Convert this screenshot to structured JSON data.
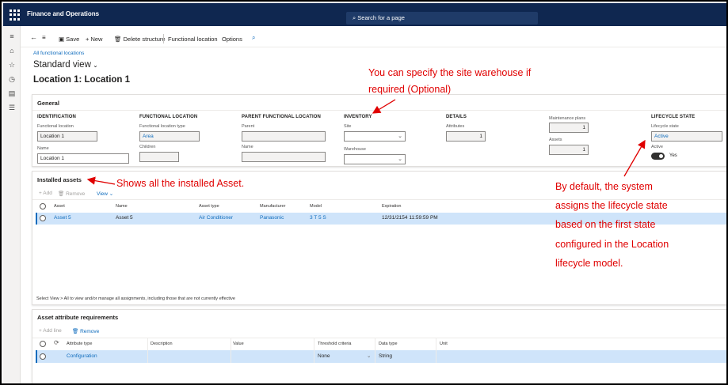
{
  "app": {
    "title": "Finance and Operations",
    "search_placeholder": "Search for a page"
  },
  "nav": {
    "icons": [
      "menu-icon",
      "home-icon",
      "star-icon",
      "recent-icon",
      "workspace-icon",
      "list-icon"
    ]
  },
  "actions": {
    "save": "Save",
    "new": "New",
    "delete_structure": "Delete structure",
    "functional_location": "Functional location",
    "options": "Options"
  },
  "page": {
    "breadcrumb": "All functional locations",
    "view": "Standard view",
    "title": "Location 1: Location 1"
  },
  "general": {
    "header": "General",
    "identification": {
      "header": "IDENTIFICATION",
      "fl_label": "Functional location",
      "fl_value": "Location 1",
      "name_label": "Name",
      "name_value": "Location 1"
    },
    "functional_location": {
      "header": "FUNCTIONAL LOCATION",
      "type_label": "Functional location type",
      "type_value": "Area",
      "children_label": "Children",
      "children_value": ""
    },
    "parent": {
      "header": "PARENT FUNCTIONAL LOCATION",
      "parent_label": "Parent",
      "parent_value": "",
      "name_label": "Name",
      "name_value": ""
    },
    "inventory": {
      "header": "INVENTORY",
      "site_label": "Site",
      "site_value": "",
      "warehouse_label": "Warehouse",
      "warehouse_value": ""
    },
    "details": {
      "header": "DETAILS",
      "attributes_label": "Attributes",
      "attributes_value": "1"
    },
    "maintenance": {
      "plans_label": "Maintenance plans",
      "plans_value": "1",
      "assets_label": "Assets",
      "assets_value": "1"
    },
    "lifecycle": {
      "header": "LIFECYCLE STATE",
      "state_label": "Lifecycle state",
      "state_value": "Active",
      "active_label": "Active",
      "active_value": "Yes"
    }
  },
  "installed": {
    "header": "Installed assets",
    "toolbar": {
      "add": "Add",
      "remove": "Remove",
      "view": "View"
    },
    "columns": [
      "Asset",
      "Name",
      "Asset type",
      "Manufacturer",
      "Model",
      "Expiration"
    ],
    "rows": [
      {
        "asset": "Asset 5",
        "name": "Asset 5",
        "type": "Air Conditioner",
        "manufacturer": "Panasonic",
        "model": "3 T 5 S",
        "expiration": "12/31/2154 11:59:59 PM"
      }
    ],
    "footer": "Select View > All to view and/or manage all assignments, including those that are not currently effective"
  },
  "attr": {
    "header": "Asset attribute requirements",
    "toolbar": {
      "add": "Add line",
      "remove": "Remove"
    },
    "columns": [
      "Attribute type",
      "Description",
      "Value",
      "Threshold criteria",
      "Data type",
      "Unit"
    ],
    "rows": [
      {
        "type": "Configuration",
        "description": "",
        "value": "",
        "threshold": "None",
        "datatype": "String",
        "unit": ""
      }
    ]
  },
  "annotations": {
    "warehouse_line1": "You can specify the site warehouse if",
    "warehouse_line2": "required (Optional)",
    "installed": "Shows all the installed Asset.",
    "lifecycle_lines": [
      "By default, the system",
      "assigns the lifecycle state",
      "based on the first state",
      "configured in the Location",
      "lifecycle model."
    ]
  },
  "colors": {
    "topbar": "#0f2750",
    "accent": "#0f6cbd",
    "annotation": "#e00000",
    "selected_row": "#cfe4fa"
  }
}
